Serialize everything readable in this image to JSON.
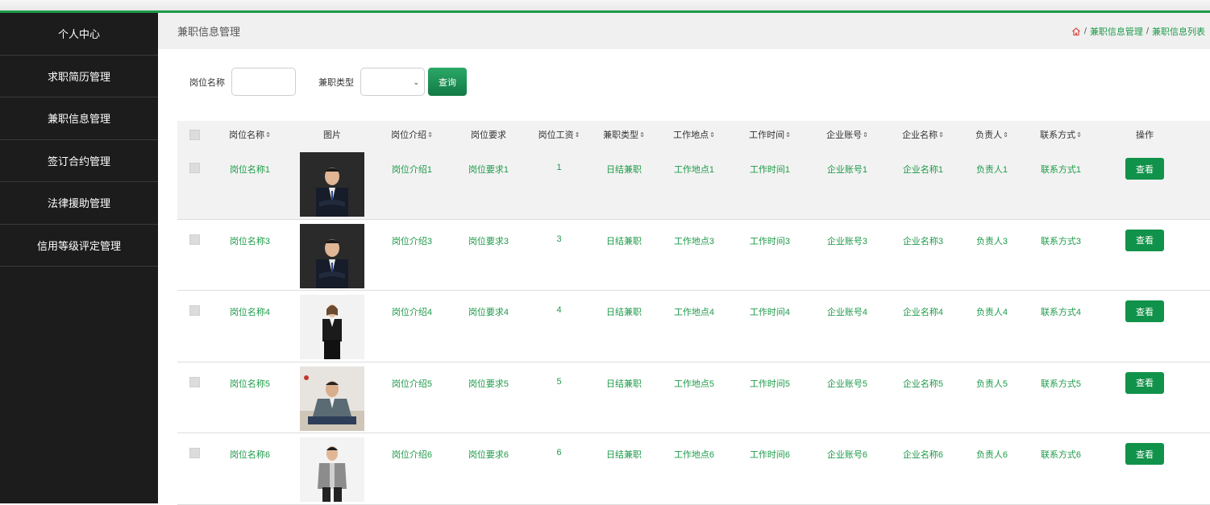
{
  "sidebar": {
    "items": [
      {
        "label": "个人中心"
      },
      {
        "label": "求职简历管理"
      },
      {
        "label": "兼职信息管理"
      },
      {
        "label": "签订合约管理"
      },
      {
        "label": "法律援助管理"
      },
      {
        "label": "信用等级评定管理"
      }
    ]
  },
  "header": {
    "title": "兼职信息管理",
    "breadcrumbs": [
      "兼职信息管理",
      "兼职信息列表"
    ],
    "separator": "/"
  },
  "search": {
    "name_label": "岗位名称",
    "name_value": "",
    "type_label": "兼职类型",
    "type_value": "",
    "chevron": "⌄",
    "query_label": "查询"
  },
  "table": {
    "columns": [
      "",
      "岗位名称",
      "图片",
      "岗位介绍",
      "岗位要求",
      "岗位工资",
      "兼职类型",
      "工作地点",
      "工作时间",
      "企业账号",
      "企业名称",
      "负责人",
      "联系方式",
      "操作"
    ],
    "sort_icon": "⇕",
    "view_label": "查看",
    "rows": [
      {
        "name": "岗位名称1",
        "intro": "岗位介绍1",
        "req": "岗位要求1",
        "wage": "1",
        "type": "日结兼职",
        "place": "工作地点1",
        "time": "工作时间1",
        "account": "企业账号1",
        "company": "企业名称1",
        "owner": "负责人1",
        "contact": "联系方式1",
        "photo": "man-dark-suit"
      },
      {
        "name": "岗位名称3",
        "intro": "岗位介绍3",
        "req": "岗位要求3",
        "wage": "3",
        "type": "日结兼职",
        "place": "工作地点3",
        "time": "工作时间3",
        "account": "企业账号3",
        "company": "企业名称3",
        "owner": "负责人3",
        "contact": "联系方式3",
        "photo": "man-dark-suit"
      },
      {
        "name": "岗位名称4",
        "intro": "岗位介绍4",
        "req": "岗位要求4",
        "wage": "4",
        "type": "日结兼职",
        "place": "工作地点4",
        "time": "工作时间4",
        "account": "企业账号4",
        "company": "企业名称4",
        "owner": "负责人4",
        "contact": "联系方式4",
        "photo": "woman-black-suit"
      },
      {
        "name": "岗位名称5",
        "intro": "岗位介绍5",
        "req": "岗位要求5",
        "wage": "5",
        "type": "日结兼职",
        "place": "工作地点5",
        "time": "工作时间5",
        "account": "企业账号5",
        "company": "企业名称5",
        "owner": "负责人5",
        "contact": "联系方式5",
        "photo": "man-seated-blazer"
      },
      {
        "name": "岗位名称6",
        "intro": "岗位介绍6",
        "req": "岗位要求6",
        "wage": "6",
        "type": "日结兼职",
        "place": "工作地点6",
        "time": "工作时间6",
        "account": "企业账号6",
        "company": "企业名称6",
        "owner": "负责人6",
        "contact": "联系方式6",
        "photo": "man-leather-jacket"
      }
    ]
  },
  "colors": {
    "accent": "#1e9b4a",
    "sidebar_bg": "#1c1c1c",
    "button": "#11924a"
  }
}
